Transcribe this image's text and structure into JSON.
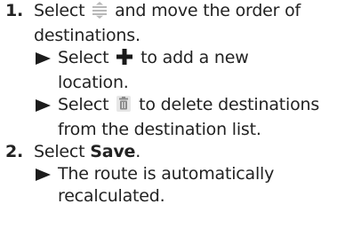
{
  "steps": [
    {
      "number": "1.",
      "line1_before": "Select",
      "line1_icon": "reorder-handle-icon",
      "line1_after": "and move the order of",
      "line2": "destinations.",
      "bullets": [
        {
          "before": "Select",
          "icon": "add-location-plus-icon",
          "after": "to add a new",
          "line2": "location."
        },
        {
          "before": "Select",
          "icon": "trash-can-icon",
          "after": "to delete destinations",
          "line2": "from the destination list."
        }
      ]
    },
    {
      "number": "2.",
      "before": "Select",
      "bold": "Save",
      "after": ".",
      "bullets": [
        {
          "line1": "The route is automatically",
          "line2": "recalculated."
        }
      ]
    }
  ],
  "colors": {
    "text": "#222222",
    "plus_icon": "#1a1a1a",
    "reorder_icon": "#b8b8b8",
    "trash_icon": "#8a8a8a"
  }
}
